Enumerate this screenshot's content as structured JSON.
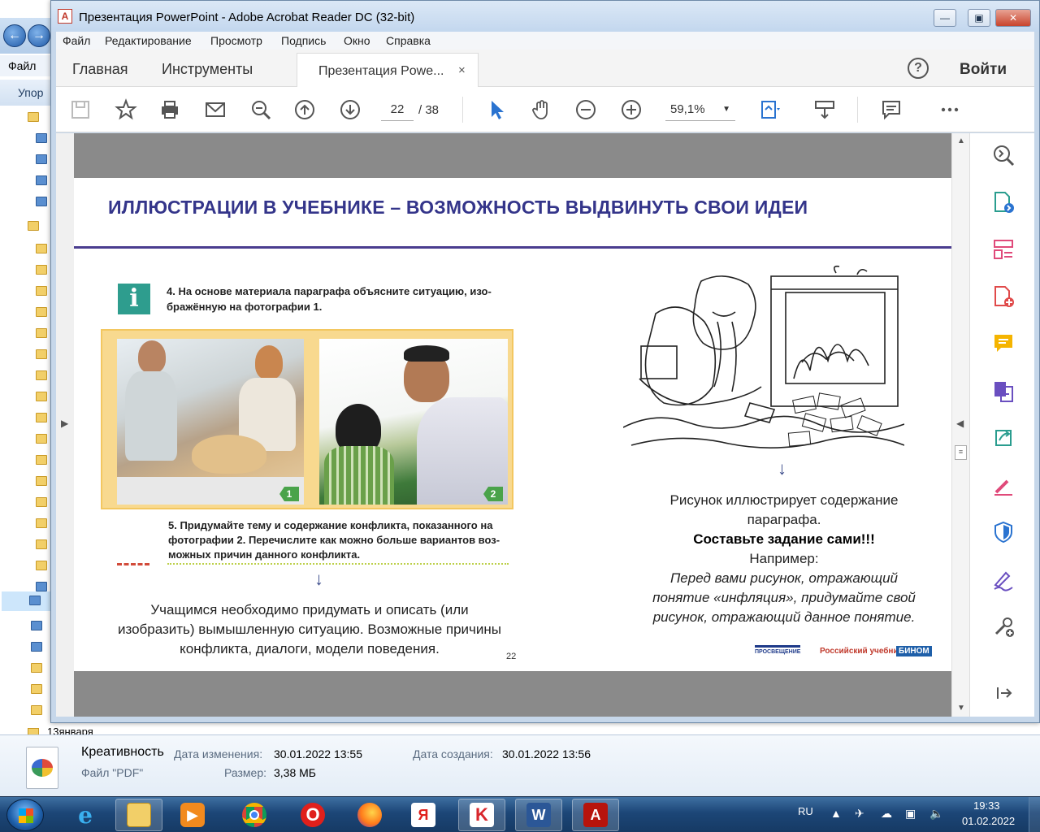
{
  "explorer": {
    "menu_label": "Файл",
    "organize_label": "Упор",
    "last_item": "13января"
  },
  "details": {
    "file_name": "Креативность",
    "modified_label": "Дата изменения:",
    "modified_value": "30.01.2022 13:55",
    "created_label": "Дата создания:",
    "created_value": "30.01.2022 13:56",
    "type": "Файл \"PDF\"",
    "size_label": "Размер:",
    "size_value": "3,38 МБ"
  },
  "taskbar": {
    "lang": "RU",
    "time": "19:33",
    "date": "01.02.2022",
    "apps": [
      "internet-explorer-icon",
      "file-explorer-icon",
      "media-player-icon",
      "chrome-icon",
      "opera-icon",
      "firefox-icon",
      "yandex-icon",
      "kaspersky-icon",
      "word-icon",
      "acrobat-icon"
    ]
  },
  "window": {
    "title": "Презентация PowerPoint - Adobe Acrobat Reader DC (32-bit)",
    "menu": [
      "Файл",
      "Редактирование",
      "Просмотр",
      "Подпись",
      "Окно",
      "Справка"
    ],
    "tabs": {
      "home": "Главная",
      "tools": "Инструменты",
      "doc": "Презентация Powe...",
      "close": "×"
    },
    "help": "?",
    "login": "Войти",
    "page_current": "22",
    "page_total": "/  38",
    "zoom": "59,1%"
  },
  "slide": {
    "title": "ИЛЛЮСТРАЦИИ В УЧЕБНИКЕ – ВОЗМОЖНОСТЬ ВЫДВИНУТЬ СВОИ ИДЕИ",
    "info_glyph": "i",
    "task4_line1": "4. На основе материала параграфа объясните ситуацию, изо-",
    "task4_line2": "бражённую на фотографии 1.",
    "photo1_badge": "1",
    "photo2_badge": "2",
    "task5_line1": "5. Придумайте тему и содержание конфликта, показанного на",
    "task5_line2": "фотографии 2. Перечислите как можно больше вариантов воз-",
    "task5_line3": "можных причин данного конфликта.",
    "left_line1": "Учащимся необходимо придумать и описать (или",
    "left_line2": "изобразить) вымышленную ситуацию. Возможные причины",
    "left_line3": "конфликта, диалоги, модели поведения.",
    "right_line1": "Рисунок иллюстрирует содержание",
    "right_line2": "параграфа.",
    "right_bold": "Составьте задание сами!!!",
    "right_example": "Например:",
    "right_italic1": "Перед вами рисунок, отражающий",
    "right_italic2": "понятие «инфляция», придумайте свой",
    "right_italic3": "рисунок, отражающий данное понятие.",
    "page_number": "22",
    "logo1": "ПРОСВЕЩЕНИЕ",
    "logo2": "Российский учебник",
    "logo3": "БИНОМ"
  },
  "colors": {
    "title": "#34358a",
    "rule": "#4a3d8f",
    "accent_icon": "#2e9d8e",
    "tool_pink": "#e04a7a",
    "tool_blue": "#2a73d0"
  }
}
